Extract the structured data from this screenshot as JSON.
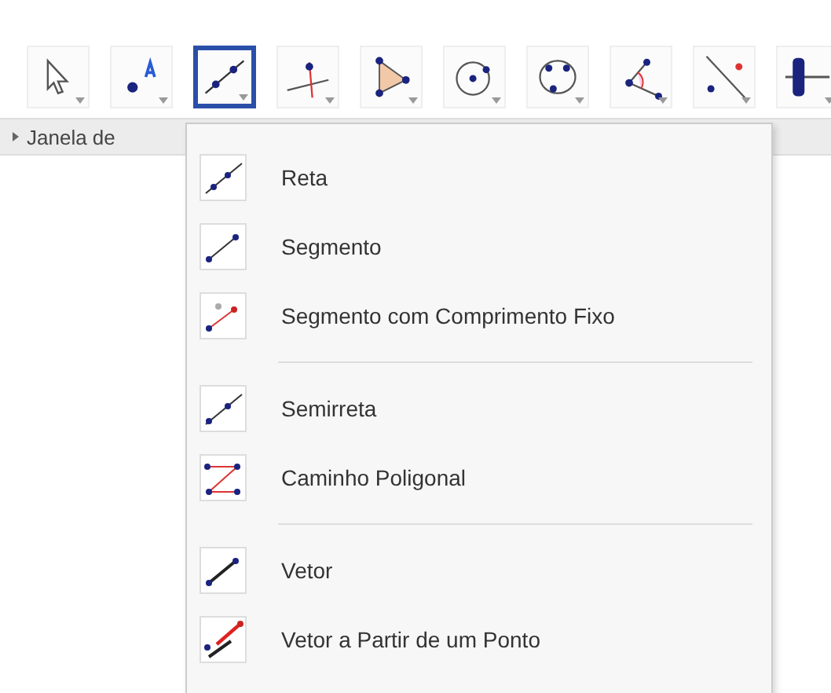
{
  "toolbar": {
    "tools": [
      {
        "kind": "pointer",
        "selected": false
      },
      {
        "kind": "point",
        "selected": false
      },
      {
        "kind": "line",
        "selected": true
      },
      {
        "kind": "perpendicular",
        "selected": false
      },
      {
        "kind": "polygon",
        "selected": false
      },
      {
        "kind": "circle",
        "selected": false
      },
      {
        "kind": "conic",
        "selected": false
      },
      {
        "kind": "angle",
        "selected": false
      },
      {
        "kind": "reflect",
        "selected": false
      },
      {
        "kind": "slider",
        "selected": false
      }
    ]
  },
  "panel_header": {
    "title": "Janela de"
  },
  "menu": {
    "groups": [
      [
        {
          "kind": "line",
          "label": "Reta"
        },
        {
          "kind": "segment",
          "label": "Segmento"
        },
        {
          "kind": "fixed",
          "label": "Segmento com Comprimento Fixo"
        }
      ],
      [
        {
          "kind": "ray",
          "label": "Semirreta"
        },
        {
          "kind": "polyline",
          "label": "Caminho Poligonal"
        }
      ],
      [
        {
          "kind": "vector",
          "label": "Vetor"
        },
        {
          "kind": "vectorfrom",
          "label": "Vetor a Partir de um Ponto"
        }
      ]
    ]
  }
}
